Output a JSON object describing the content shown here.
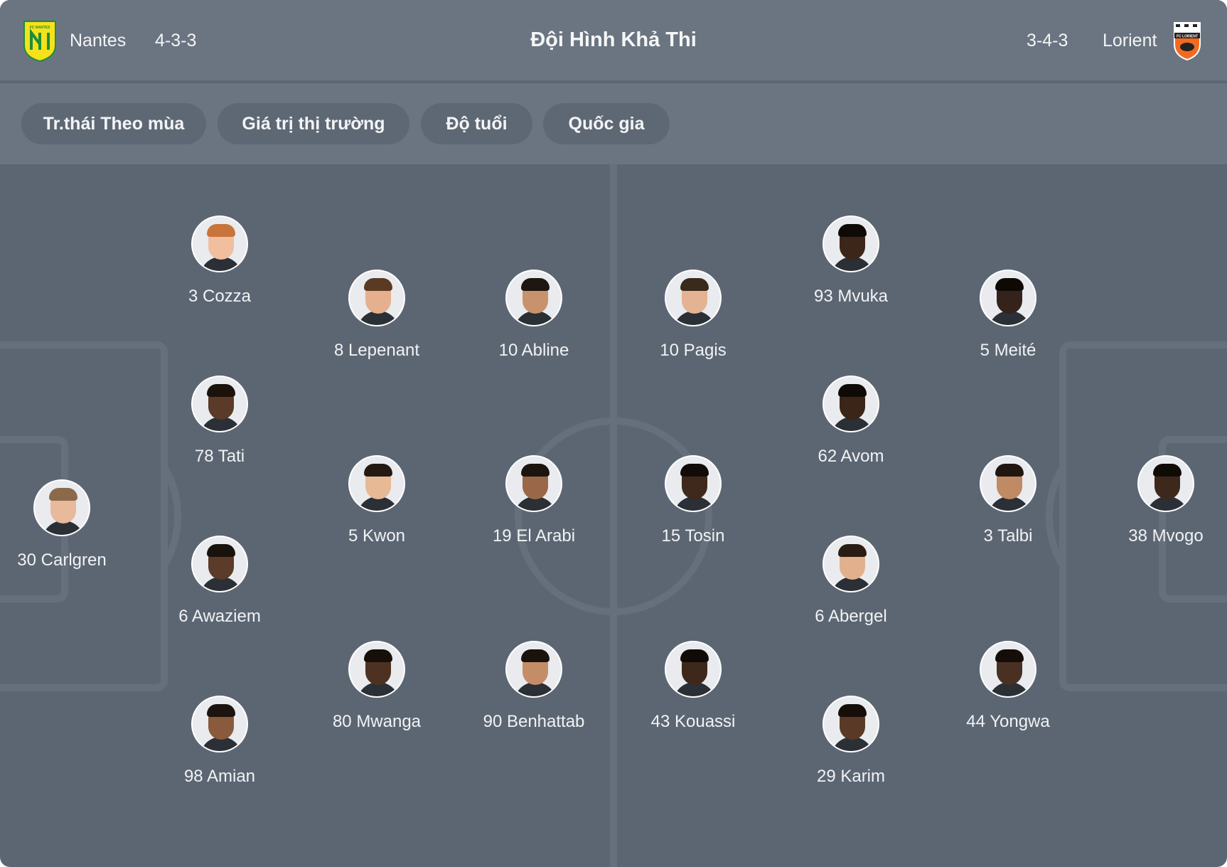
{
  "header": {
    "title": "Đội Hình Khả Thi",
    "home": {
      "name": "Nantes",
      "formation": "4-3-3",
      "crest_text": "FC NANTES",
      "crest_color": "#f5e21b",
      "crest_accent": "#1d8c3c"
    },
    "away": {
      "name": "Lorient",
      "formation": "3-4-3",
      "crest_text": "FC LORIENT",
      "crest_color": "#f26a21",
      "crest_accent": "#222222"
    }
  },
  "tabs": [
    {
      "label": "Tr.thái Theo mùa"
    },
    {
      "label": "Giá trị thị trường"
    },
    {
      "label": "Độ tuổi"
    },
    {
      "label": "Quốc gia"
    }
  ],
  "players": [
    {
      "label": "30 Carlgren",
      "skin": "#e8b99a",
      "hair": "#8a6a4a"
    },
    {
      "label": "3 Cozza",
      "skin": "#f0bfa0",
      "hair": "#c9743a"
    },
    {
      "label": "78 Tati",
      "skin": "#5a3a28",
      "hair": "#1b120c"
    },
    {
      "label": "6 Awaziem",
      "skin": "#5b3b29",
      "hair": "#1a120d"
    },
    {
      "label": "98 Amian",
      "skin": "#8a5a3c",
      "hair": "#1c140f"
    },
    {
      "label": "8 Lepenant",
      "skin": "#e6b08e",
      "hair": "#5a3a22"
    },
    {
      "label": "5 Kwon",
      "skin": "#e7b995",
      "hair": "#241a12"
    },
    {
      "label": "80 Mwanga",
      "skin": "#4d3222",
      "hair": "#160f0a"
    },
    {
      "label": "10 Abline",
      "skin": "#c8926d",
      "hair": "#1e1610"
    },
    {
      "label": "19 El Arabi",
      "skin": "#9a6848",
      "hair": "#1b140f"
    },
    {
      "label": "90 Benhattab",
      "skin": "#c48d68",
      "hair": "#1a130d"
    },
    {
      "label": "10 Pagis",
      "skin": "#e3b393",
      "hair": "#3a2a1c"
    },
    {
      "label": "15 Tosin",
      "skin": "#3f291c",
      "hair": "#120c08"
    },
    {
      "label": "43 Kouassi",
      "skin": "#3d281b",
      "hair": "#110b07"
    },
    {
      "label": "93 Mvuka",
      "skin": "#3c2619",
      "hair": "#0f0a06"
    },
    {
      "label": "62 Avom",
      "skin": "#3a2518",
      "hair": "#0f0a06"
    },
    {
      "label": "6 Abergel",
      "skin": "#e2b08c",
      "hair": "#2a1e14"
    },
    {
      "label": "29 Karim",
      "skin": "#5a3a26",
      "hair": "#150e09"
    },
    {
      "label": "5 Meité",
      "skin": "#35221a",
      "hair": "#0e0905"
    },
    {
      "label": "3 Talbi",
      "skin": "#c08a64",
      "hair": "#201710"
    },
    {
      "label": "44 Yongwa",
      "skin": "#4a3022",
      "hair": "#140d08"
    },
    {
      "label": "38 Mvogo",
      "skin": "#3e281c",
      "hair": "#110b07"
    }
  ]
}
